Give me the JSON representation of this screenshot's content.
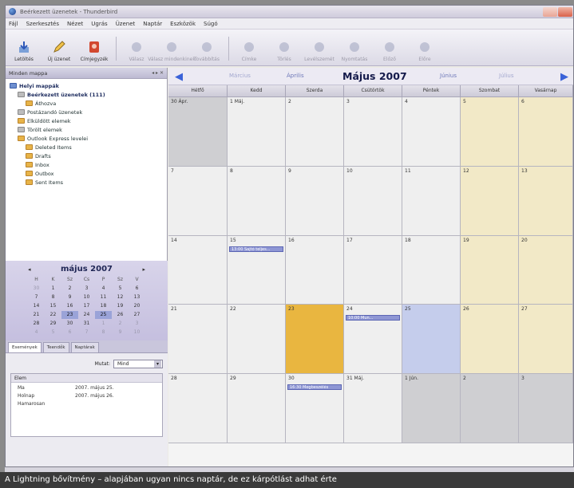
{
  "window": {
    "title": "Beérkezett üzenetek - Thunderbird"
  },
  "menu": [
    "Fájl",
    "Szerkesztés",
    "Nézet",
    "Ugrás",
    "Üzenet",
    "Naptár",
    "Eszközök",
    "Súgó"
  ],
  "toolbar": {
    "buttons": [
      {
        "label": "Letöltés",
        "icon": "download-icon",
        "dim": false
      },
      {
        "label": "Új üzenet",
        "icon": "pencil-icon",
        "dim": false
      },
      {
        "label": "Címjegyzék",
        "icon": "address-book-icon",
        "dim": false
      },
      {
        "label": "Válasz",
        "icon": "reply-icon",
        "dim": true
      },
      {
        "label": "Válasz mindenkinek",
        "icon": "reply-all-icon",
        "dim": true
      },
      {
        "label": "Továbbítás",
        "icon": "forward-icon",
        "dim": true
      },
      {
        "label": "Címke",
        "icon": "tag-icon",
        "dim": true
      },
      {
        "label": "Törlés",
        "icon": "delete-icon",
        "dim": true
      },
      {
        "label": "Levélszemét",
        "icon": "junk-icon",
        "dim": true
      },
      {
        "label": "Nyomtatás",
        "icon": "print-icon",
        "dim": true
      },
      {
        "label": "Előző",
        "icon": "back-icon",
        "dim": true
      },
      {
        "label": "Előre",
        "icon": "next-icon",
        "dim": true
      }
    ]
  },
  "sidebar": {
    "header": "Minden mappa",
    "tree": [
      {
        "label": "Helyi mappák",
        "level": 0,
        "bold": true,
        "icon": "blue"
      },
      {
        "label": "Beérkezett üzenetek (111)",
        "level": 1,
        "bold": true,
        "icon": "gray"
      },
      {
        "label": "Áthozva",
        "level": 2,
        "bold": false,
        "icon": "yellow"
      },
      {
        "label": "Postázandó üzenetek",
        "level": 1,
        "bold": false,
        "icon": "gray"
      },
      {
        "label": "Elküldött elemek",
        "level": 1,
        "bold": false,
        "icon": "yellow"
      },
      {
        "label": "Törölt elemek",
        "level": 1,
        "bold": false,
        "icon": "gray"
      },
      {
        "label": "Outlook Express levelei",
        "level": 1,
        "bold": false,
        "icon": "yellow"
      },
      {
        "label": "Deleted Items",
        "level": 2,
        "bold": false,
        "icon": "yellow"
      },
      {
        "label": "Drafts",
        "level": 2,
        "bold": false,
        "icon": "yellow"
      },
      {
        "label": "Inbox",
        "level": 2,
        "bold": false,
        "icon": "yellow"
      },
      {
        "label": "Outbox",
        "level": 2,
        "bold": false,
        "icon": "yellow"
      },
      {
        "label": "Sent Items",
        "level": 2,
        "bold": false,
        "icon": "yellow"
      }
    ]
  },
  "mini_calendar": {
    "title": "május 2007",
    "weekdays": [
      "H",
      "K",
      "Sz",
      "Cs",
      "P",
      "Sz",
      "V"
    ],
    "weeks": [
      [
        "30",
        "1",
        "2",
        "3",
        "4",
        "5",
        "6"
      ],
      [
        "7",
        "8",
        "9",
        "10",
        "11",
        "12",
        "13"
      ],
      [
        "14",
        "15",
        "16",
        "17",
        "18",
        "19",
        "20"
      ],
      [
        "21",
        "22",
        "23",
        "24",
        "25",
        "26",
        "27"
      ],
      [
        "28",
        "29",
        "30",
        "31",
        "1",
        "2",
        "3"
      ],
      [
        "4",
        "5",
        "6",
        "7",
        "8",
        "9",
        "10"
      ]
    ]
  },
  "side_tabs": [
    "Események",
    "Teendők",
    "Naptárak"
  ],
  "events_pane": {
    "show_label": "Mutat:",
    "show_value": "Mind",
    "list_header": "Elem",
    "rows": [
      {
        "c1": "Ma",
        "c2": "2007. május 25."
      },
      {
        "c1": "Holnap",
        "c2": "2007. május 26."
      },
      {
        "c1": "Hamarosan",
        "c2": ""
      }
    ]
  },
  "nav": {
    "prev_prev": "Március",
    "prev": "Április",
    "current": "Május 2007",
    "next": "Június",
    "next_next": "Július"
  },
  "day_headers": [
    "Hétfő",
    "Kedd",
    "Szerda",
    "Csütörtök",
    "Péntek",
    "Szombat",
    "Vasárnap"
  ],
  "month": {
    "weeks": [
      [
        {
          "n": "30 Ápr.",
          "t": "other"
        },
        {
          "n": "1 Máj.",
          "t": ""
        },
        {
          "n": "2",
          "t": ""
        },
        {
          "n": "3",
          "t": ""
        },
        {
          "n": "4",
          "t": ""
        },
        {
          "n": "5",
          "t": "weekend"
        },
        {
          "n": "6",
          "t": "weekend"
        }
      ],
      [
        {
          "n": "7",
          "t": ""
        },
        {
          "n": "8",
          "t": ""
        },
        {
          "n": "9",
          "t": ""
        },
        {
          "n": "10",
          "t": ""
        },
        {
          "n": "11",
          "t": ""
        },
        {
          "n": "12",
          "t": "weekend"
        },
        {
          "n": "13",
          "t": "weekend"
        }
      ],
      [
        {
          "n": "14",
          "t": ""
        },
        {
          "n": "15",
          "t": "",
          "ev": "13:00 Sajtó teljes..."
        },
        {
          "n": "16",
          "t": ""
        },
        {
          "n": "17",
          "t": ""
        },
        {
          "n": "18",
          "t": ""
        },
        {
          "n": "19",
          "t": "weekend"
        },
        {
          "n": "20",
          "t": "weekend"
        }
      ],
      [
        {
          "n": "21",
          "t": ""
        },
        {
          "n": "22",
          "t": ""
        },
        {
          "n": "23",
          "t": "today"
        },
        {
          "n": "24",
          "t": "",
          "ev": "10:00 Mun..."
        },
        {
          "n": "25",
          "t": "sel"
        },
        {
          "n": "26",
          "t": "weekend"
        },
        {
          "n": "27",
          "t": "weekend"
        }
      ],
      [
        {
          "n": "28",
          "t": ""
        },
        {
          "n": "29",
          "t": ""
        },
        {
          "n": "30",
          "t": "",
          "ev": "16:30 Megbeszélés"
        },
        {
          "n": "31 Máj.",
          "t": ""
        },
        {
          "n": "1 Jún.",
          "t": "other"
        },
        {
          "n": "2",
          "t": "other"
        },
        {
          "n": "3",
          "t": "other"
        }
      ]
    ]
  },
  "caption": "A Lightning bővítmény – alapjában ugyan nincs naptár, de ez kárpótlást adhat érte"
}
